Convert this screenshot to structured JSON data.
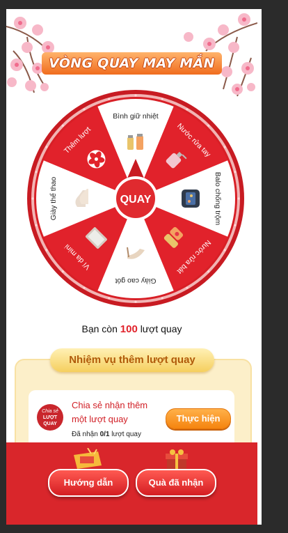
{
  "title": "VÒNG QUAY MAY MẮN",
  "wheel": {
    "spin_label": "QUAY",
    "segments": [
      {
        "label": "Bình giữ nhiệt",
        "icon": "thermos-icon",
        "color": "#ffffff"
      },
      {
        "label": "Nước rửa tay",
        "icon": "hand-wash-bottle-icon",
        "color": "#e1222b"
      },
      {
        "label": "Balo chống trộm",
        "icon": "backpack-icon",
        "color": "#ffffff"
      },
      {
        "label": "Nước rửa bát",
        "icon": "dish-soap-icon",
        "color": "#e1222b"
      },
      {
        "label": "Giày cao gót",
        "icon": "high-heels-icon",
        "color": "#ffffff"
      },
      {
        "label": "Ví da mini",
        "icon": "wallet-icon",
        "color": "#e1222b"
      },
      {
        "label": "Giày thể thao",
        "icon": "sneakers-icon",
        "color": "#ffffff"
      },
      {
        "label": "Thêm lượt",
        "icon": "blossom-icon",
        "color": "#e1222b"
      }
    ]
  },
  "remaining": {
    "prefix": "Bạn còn",
    "count": "100",
    "suffix": "lượt quay"
  },
  "mission": {
    "title": "Nhiệm vụ thêm lượt quay",
    "task": {
      "icon_text_top": "Chia sẻ",
      "icon_text_mid": "LƯỢT",
      "icon_text_bot": "QUAY",
      "title": "Chia sẻ nhận thêm một lượt quay",
      "progress_prefix": "Đã nhận",
      "progress_value": "0/1",
      "progress_suffix": "lượt quay",
      "button": "Thực hiện"
    }
  },
  "footer": {
    "guide": "Hướng dẫn",
    "received": "Quà đã nhận"
  },
  "colors": {
    "primary": "#e1222b",
    "accent": "#f5840f",
    "mission_bg": "#fcefc9"
  }
}
